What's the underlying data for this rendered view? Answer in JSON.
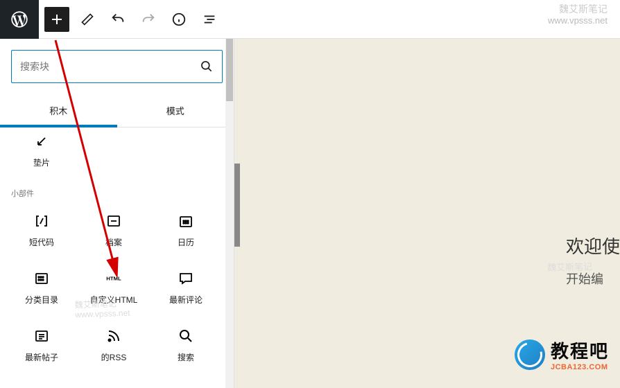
{
  "topbar": {
    "wp_logo": "wordpress-logo"
  },
  "inserter": {
    "search": {
      "placeholder": "搜索块"
    },
    "tabs": {
      "blocks": "积木",
      "patterns": "模式"
    },
    "first_block": {
      "label": "垫片",
      "icon": "spacer-icon"
    },
    "section_widgets": "小部件",
    "widgets": [
      {
        "label": "短代码",
        "icon": "shortcode-icon"
      },
      {
        "label": "档案",
        "icon": "archives-icon"
      },
      {
        "label": "日历",
        "icon": "calendar-icon"
      },
      {
        "label": "分类目录",
        "icon": "categories-icon"
      },
      {
        "label": "自定义HTML",
        "icon": "html-icon"
      },
      {
        "label": "最新评论",
        "icon": "comments-icon"
      },
      {
        "label": "最新帖子",
        "icon": "latest-posts-icon"
      },
      {
        "label": "的RSS",
        "icon": "rss-icon"
      },
      {
        "label": "搜索",
        "icon": "search-icon"
      }
    ]
  },
  "canvas": {
    "line1": "欢迎使",
    "line2": "开始编"
  },
  "watermarks": {
    "top": {
      "cn": "魏艾斯笔记",
      "url": "www.vpsss.net"
    },
    "mid": {
      "cn": "魏艾斯笔记",
      "url": "www.vpsss.net"
    },
    "right": {
      "cn": "魏艾斯笔记"
    }
  },
  "brand": {
    "name": "教程吧",
    "url": "JCBA123.COM"
  }
}
